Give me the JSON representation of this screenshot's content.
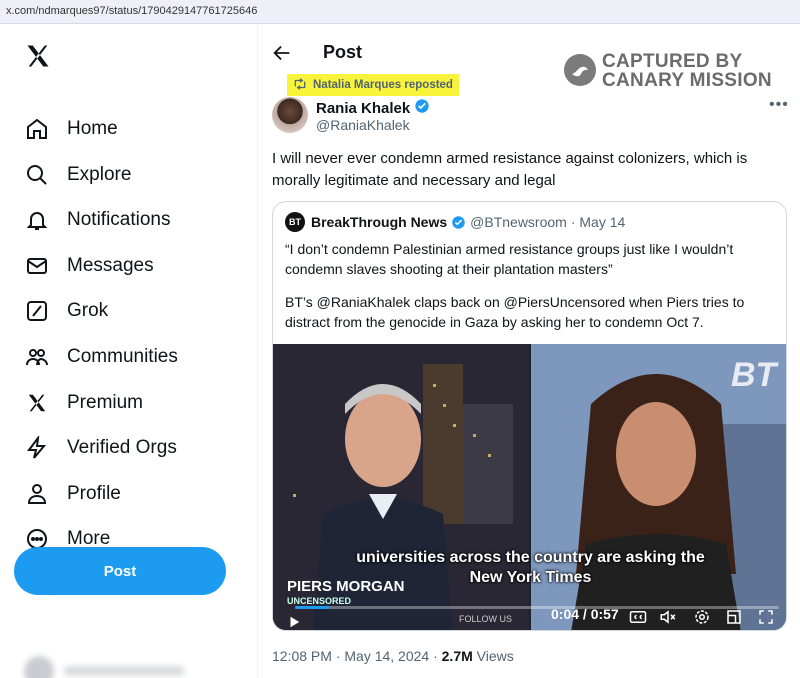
{
  "browser": {
    "url": "x.com/ndmarques97/status/1790429147761725646"
  },
  "nav": {
    "logo_icon": "x-logo-icon",
    "items": [
      {
        "label": "Home",
        "icon": "home-icon"
      },
      {
        "label": "Explore",
        "icon": "search-icon"
      },
      {
        "label": "Notifications",
        "icon": "bell-icon"
      },
      {
        "label": "Messages",
        "icon": "envelope-icon"
      },
      {
        "label": "Grok",
        "icon": "grok-icon"
      },
      {
        "label": "Communities",
        "icon": "people-icon"
      },
      {
        "label": "Premium",
        "icon": "x-logo-icon"
      },
      {
        "label": "Verified Orgs",
        "icon": "lightning-icon"
      },
      {
        "label": "Profile",
        "icon": "person-icon"
      },
      {
        "label": "More",
        "icon": "more-circle-icon"
      }
    ],
    "post_button": "Post"
  },
  "header": {
    "title": "Post"
  },
  "watermark": {
    "line1": "CAPTURED BY",
    "line2": "CANARY MISSION"
  },
  "repost": {
    "label": "Natalia Marques reposted"
  },
  "tweet": {
    "author": "Rania Khalek",
    "handle": "@RaniaKhalek",
    "text": "I will never ever condemn armed resistance against colonizers, which is morally legitimate and necessary and legal",
    "time": "12:08 PM · May 14, 2024 · ",
    "views_count": "2.7M",
    "views_label": " Views"
  },
  "quote": {
    "avatar_text": "BT",
    "author": "BreakThrough News",
    "handle": "@BTnewsroom",
    "date": "· May 14",
    "text1": "“I don’t condemn Palestinian armed resistance groups just like I wouldn’t condemn slaves shooting at their plantation masters”",
    "text2": "BT’s @RaniaKhalek claps back on @PiersUncensored when Piers tries to distract from the genocide in Gaza by asking her to condemn Oct 7.",
    "video": {
      "logo": "BT",
      "caption1": "universities across the country are asking the",
      "caption2": "New York Times",
      "show_name": "PIERS MORGAN",
      "show_sub": "UNCENSORED",
      "follow": "FOLLOW US",
      "time": "0:04 / 0:57",
      "progress": 0.07
    }
  },
  "colors": {
    "accent": "#1d9bf0",
    "highlight": "#f8f33b",
    "muted": "#536471"
  }
}
